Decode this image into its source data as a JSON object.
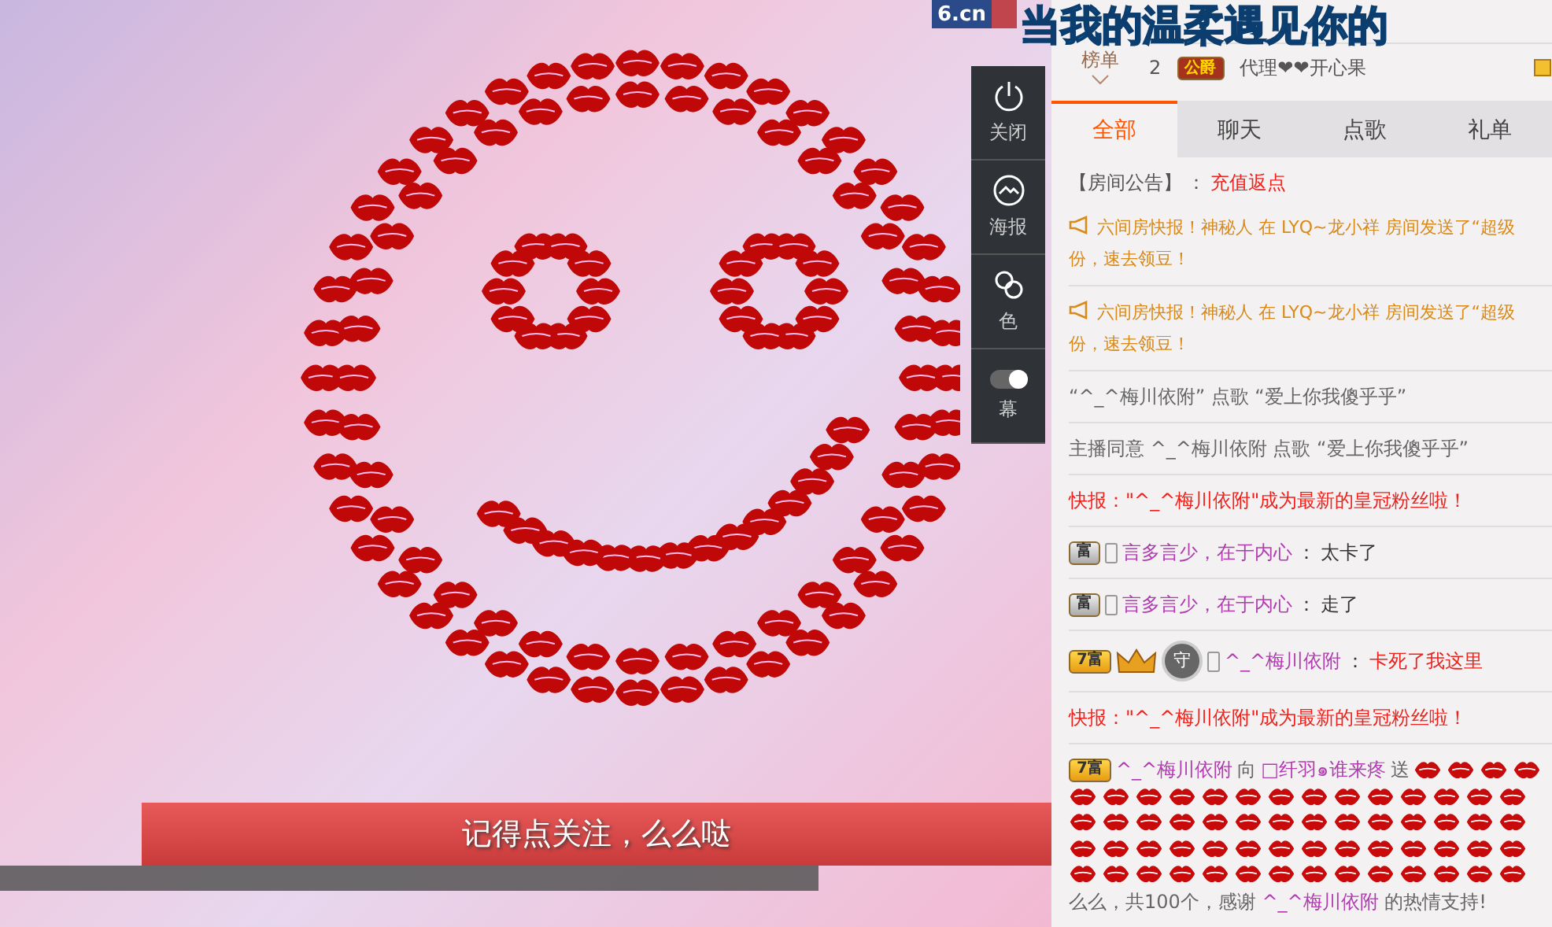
{
  "logo": {
    "text": "6.cn"
  },
  "banner_text": "当我的温柔遇见你的",
  "video": {
    "caption": "记得点关注，么么哒"
  },
  "side_toolbar": [
    {
      "kind": "power",
      "label": "关闭"
    },
    {
      "kind": "poster",
      "label": "海报"
    },
    {
      "kind": "color",
      "label": "色"
    },
    {
      "kind": "toggle",
      "label": "幕"
    }
  ],
  "ranking": {
    "label": "榜单",
    "rows": [
      {
        "rank": "2",
        "badge": "公爵",
        "name": "代理❤❤开心果"
      }
    ]
  },
  "tabs": [
    {
      "label": "全部",
      "selected": true
    },
    {
      "label": "聊天",
      "selected": false
    },
    {
      "label": "点歌",
      "selected": false
    },
    {
      "label": "礼单",
      "selected": false
    }
  ],
  "announcement": {
    "label": "【房间公告】",
    "separator": "：",
    "text": "充值返点"
  },
  "messages": [
    {
      "kind": "broadcast",
      "lines": [
        "六间房快报！神秘人 在 LYQ~龙小祥 房间发送了“超级",
        "份，速去领豆！"
      ]
    },
    {
      "kind": "broadcast",
      "lines": [
        "六间房快报！神秘人 在 LYQ~龙小祥 房间发送了“超级",
        "份，速去领豆！"
      ]
    },
    {
      "kind": "system",
      "text": "“^_^梅川依附” 点歌 “爱上你我傻乎乎”"
    },
    {
      "kind": "system",
      "text": "主播同意 ^_^梅川依附 点歌 “爱上你我傻乎乎”"
    },
    {
      "kind": "alert",
      "text": "快报：\"^_^梅川依附\"成为最新的皇冠粉丝啦！"
    },
    {
      "kind": "chat",
      "badge": {
        "kind": "silver",
        "label": "富"
      },
      "icons": [
        {
          "kind": "phone"
        }
      ],
      "user": "言多言少，在于内心",
      "separator": "：",
      "text": "太卡了",
      "highlight": false
    },
    {
      "kind": "chat",
      "badge": {
        "kind": "silver",
        "label": "富"
      },
      "icons": [
        {
          "kind": "phone"
        }
      ],
      "user": "言多言少，在于内心",
      "separator": "：",
      "text": "走了",
      "highlight": false
    },
    {
      "kind": "chat",
      "badge": {
        "kind": "gold",
        "label": "7富"
      },
      "icons": [
        {
          "kind": "crown"
        },
        {
          "kind": "guard",
          "label": "守"
        },
        {
          "kind": "phone"
        }
      ],
      "user": "^_^梅川依附",
      "separator": "：",
      "text": "卡死了我这里",
      "highlight": true
    },
    {
      "kind": "alert",
      "text": "快报：\"^_^梅川依附\"成为最新的皇冠粉丝啦！"
    },
    {
      "kind": "gift",
      "badge": {
        "kind": "gold",
        "label": "7富"
      },
      "user": "^_^梅川依附",
      "verb": "向",
      "target": "□纤羽๑谁来疼",
      "action": "送",
      "footer_before": "么么，共100个，感谢 ",
      "footer_user": "^_^梅川依附",
      "footer_after": " 的热情支持!"
    }
  ]
}
